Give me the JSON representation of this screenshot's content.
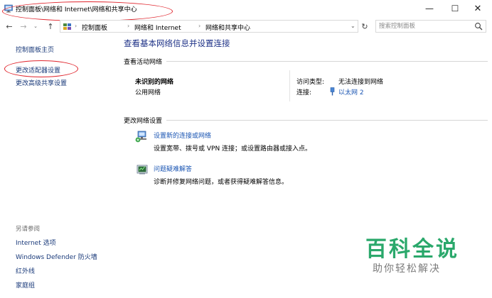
{
  "window": {
    "title": "控制面板\\网络和 Internet\\网络和共享中心",
    "minimize_glyph": "—",
    "maximize_glyph": "☐",
    "close_glyph": "✕"
  },
  "address_bar": {
    "back_glyph": "←",
    "forward_glyph": "→",
    "recent_glyph": "⌄",
    "up_glyph": "↑",
    "breadcrumbs": [
      "控制面板",
      "网络和 Internet",
      "网络和共享中心"
    ],
    "separator": "›",
    "dropdown_glyph": "⌄",
    "refresh_glyph": "↻"
  },
  "search": {
    "placeholder": "搜索控制面板"
  },
  "sidebar": {
    "home_label": "控制面板主页",
    "items": [
      {
        "label": "更改适配器设置"
      },
      {
        "label": "更改高级共享设置"
      }
    ],
    "see_also_title": "另请参阅",
    "see_also": [
      {
        "label": "Internet 选项"
      },
      {
        "label": "Windows Defender 防火墙"
      },
      {
        "label": "红外线"
      },
      {
        "label": "家庭组"
      }
    ]
  },
  "main": {
    "title": "查看基本网络信息并设置连接",
    "active_networks": {
      "heading": "查看活动网络",
      "network_name": "未识别的网络",
      "network_category": "公用网络",
      "access_type_label": "访问类型:",
      "access_type_value": "无法连接到网络",
      "connections_label": "连接:",
      "connections_value": "以太网 2"
    },
    "change_settings": {
      "heading": "更改网络设置",
      "tasks": [
        {
          "icon": "network-setup-icon",
          "link": "设置新的连接或网络",
          "desc": "设置宽带、拨号或 VPN 连接；或设置路由器或接入点。"
        },
        {
          "icon": "troubleshoot-icon",
          "link": "问题疑难解答",
          "desc": "诊断并修复网络问题，或者获得疑难解答信息。"
        }
      ]
    }
  },
  "watermark": {
    "main": "百科全说",
    "sub": "助你轻松解决"
  },
  "colors": {
    "link_blue": "#1a55b3",
    "title_blue": "#1e3287",
    "annotation_red": "#e0242c",
    "watermark_green": "#2aa86b"
  }
}
